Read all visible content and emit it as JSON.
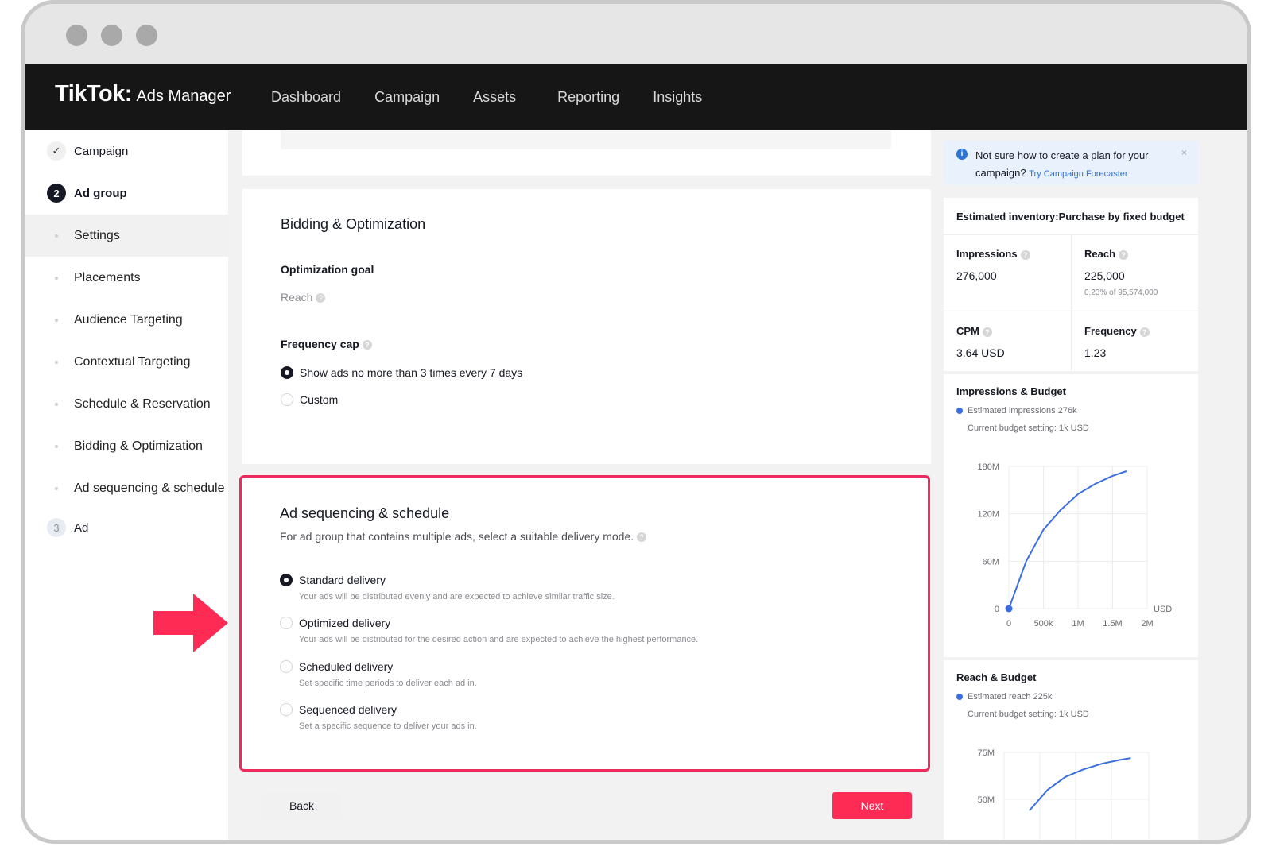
{
  "app": {
    "brand": "TikTok",
    "brand_sub": "Ads Manager"
  },
  "nav": {
    "items": [
      "Dashboard",
      "Campaign",
      "Assets",
      "Reporting",
      "Insights"
    ]
  },
  "sidebar": {
    "steps": [
      {
        "badge": "✓",
        "label": "Campaign"
      },
      {
        "badge": "2",
        "label": "Ad group"
      },
      {
        "badge": "3",
        "label": "Ad"
      }
    ],
    "sub_items": [
      "Settings",
      "Placements",
      "Audience Targeting",
      "Contextual Targeting",
      "Schedule & Reservation",
      "Bidding & Optimization",
      "Ad sequencing & schedule"
    ]
  },
  "bidding": {
    "title": "Bidding & Optimization",
    "goal_label": "Optimization goal",
    "goal_value": "Reach",
    "freq_label": "Frequency cap",
    "freq_options": [
      "Show ads no more than 3 times every 7 days",
      "Custom"
    ],
    "freq_selected": 0
  },
  "sequencing": {
    "title": "Ad sequencing & schedule",
    "description": "For ad group that contains multiple ads, select a suitable delivery mode.",
    "selected": 0,
    "options": [
      {
        "label": "Standard delivery",
        "desc": "Your ads will be distributed evenly and are expected to achieve similar traffic size."
      },
      {
        "label": "Optimized delivery",
        "desc": "Your ads will be distributed for the desired action and are expected to achieve the highest performance."
      },
      {
        "label": "Scheduled delivery",
        "desc": "Set specific time periods to deliver each ad in."
      },
      {
        "label": "Sequenced delivery",
        "desc": "Set a specific sequence to deliver your ads in."
      }
    ]
  },
  "buttons": {
    "back": "Back",
    "next": "Next"
  },
  "info_banner": {
    "text": "Not sure how to create a plan for your campaign?",
    "link": "Try Campaign Forecaster",
    "close": "×"
  },
  "inventory": {
    "title": "Estimated inventory:Purchase by fixed budget",
    "impressions_label": "Impressions",
    "impressions_value": "276,000",
    "reach_label": "Reach",
    "reach_value": "225,000",
    "reach_sub": "0.23% of 95,574,000",
    "cpm_label": "CPM",
    "cpm_value": "3.64 USD",
    "frequency_label": "Frequency",
    "frequency_value": "1.23"
  },
  "impressions_budget": {
    "title": "Impressions & Budget",
    "legend": "Estimated impressions 276k",
    "budget_note": "Current budget setting: 1k USD"
  },
  "reach_budget": {
    "title": "Reach & Budget",
    "legend": "Estimated reach 225k",
    "budget_note": "Current budget setting: 1k USD"
  },
  "colors": {
    "accent": "#fe2c55",
    "highlight_border": "#ef2a5e",
    "chart_line": "#3b6ee0",
    "nav_bg": "#161616"
  },
  "chart_data": [
    {
      "type": "line",
      "title": "Impressions & Budget",
      "xlabel": "USD",
      "x_ticks": [
        "0",
        "500k",
        "1M",
        "1.5M",
        "2M"
      ],
      "y_ticks": [
        "0",
        "60M",
        "120M",
        "180M"
      ],
      "xlim": [
        0,
        2000000
      ],
      "ylim": [
        0,
        180000000
      ],
      "series": [
        {
          "name": "Estimated impressions 276k",
          "x": [
            0,
            250000,
            500000,
            750000,
            1000000,
            1250000,
            1500000,
            1700000
          ],
          "y": [
            0,
            60000000,
            100000000,
            125000000,
            145000000,
            158000000,
            168000000,
            174000000
          ]
        }
      ],
      "marker": {
        "x": 1000,
        "y": 276000
      }
    },
    {
      "type": "line",
      "title": "Reach & Budget",
      "y_ticks": [
        "50M",
        "75M"
      ],
      "series": [
        {
          "name": "Estimated reach 225k",
          "x": [
            0.35,
            0.6,
            0.85,
            1.1,
            1.35,
            1.6,
            1.75
          ],
          "y": [
            44,
            55,
            62,
            66,
            69,
            71,
            72
          ]
        }
      ]
    }
  ]
}
